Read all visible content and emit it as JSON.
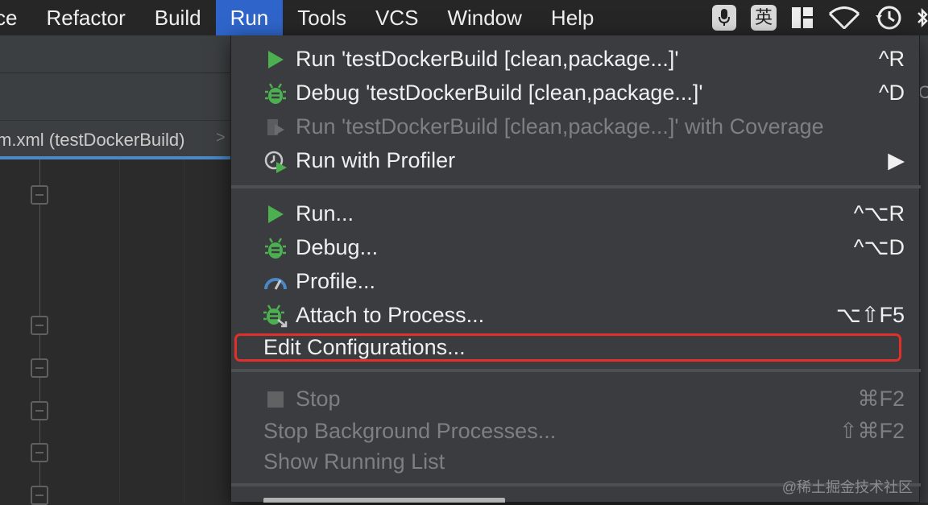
{
  "menubar": {
    "items": [
      "ce",
      "Refactor",
      "Build",
      "Run",
      "Tools",
      "VCS",
      "Window",
      "Help"
    ],
    "active_index": 3,
    "lang_label": "英"
  },
  "editor": {
    "tab_label": "m.xml (testDockerBuild)",
    "tab_arrow": ">",
    "right_edge_char": "C"
  },
  "menu": {
    "items": [
      {
        "label": "Run 'testDockerBuild [clean,package...]'",
        "shortcut": "^R",
        "icon": "run-play-icon",
        "enabled": true
      },
      {
        "label": "Debug 'testDockerBuild [clean,package...]'",
        "shortcut": "^D",
        "icon": "debug-bug-icon",
        "enabled": true
      },
      {
        "label": "Run 'testDockerBuild [clean,package...]' with Coverage",
        "shortcut": "",
        "icon": "coverage-icon",
        "enabled": false
      },
      {
        "label": "Run with Profiler",
        "shortcut": "▶",
        "icon": "profiler-icon",
        "enabled": true
      },
      {
        "label": "Run...",
        "shortcut": "^⌥R",
        "icon": "run-play-icon",
        "enabled": true
      },
      {
        "label": "Debug...",
        "shortcut": "^⌥D",
        "icon": "debug-bug-icon",
        "enabled": true
      },
      {
        "label": "Profile...",
        "shortcut": "",
        "icon": "gauge-icon",
        "enabled": true
      },
      {
        "label": "Attach to Process...",
        "shortcut": "⌥⇧F5",
        "icon": "attach-bug-icon",
        "enabled": true
      },
      {
        "label": "Edit Configurations...",
        "shortcut": "",
        "icon": "",
        "enabled": true
      },
      {
        "label": "Stop",
        "shortcut": "⌘F2",
        "icon": "stop-icon",
        "enabled": false
      },
      {
        "label": "Stop Background Processes...",
        "shortcut": "⇧⌘F2",
        "icon": "",
        "enabled": false
      },
      {
        "label": "Show Running List",
        "shortcut": "",
        "icon": "",
        "enabled": false
      }
    ]
  },
  "watermark": "@稀土掘金技术社区",
  "colors": {
    "menu_accent": "#2f65ca",
    "run_green": "#4caf50",
    "highlight_red": "#e1302a",
    "tab_underline": "#4a88c7"
  }
}
